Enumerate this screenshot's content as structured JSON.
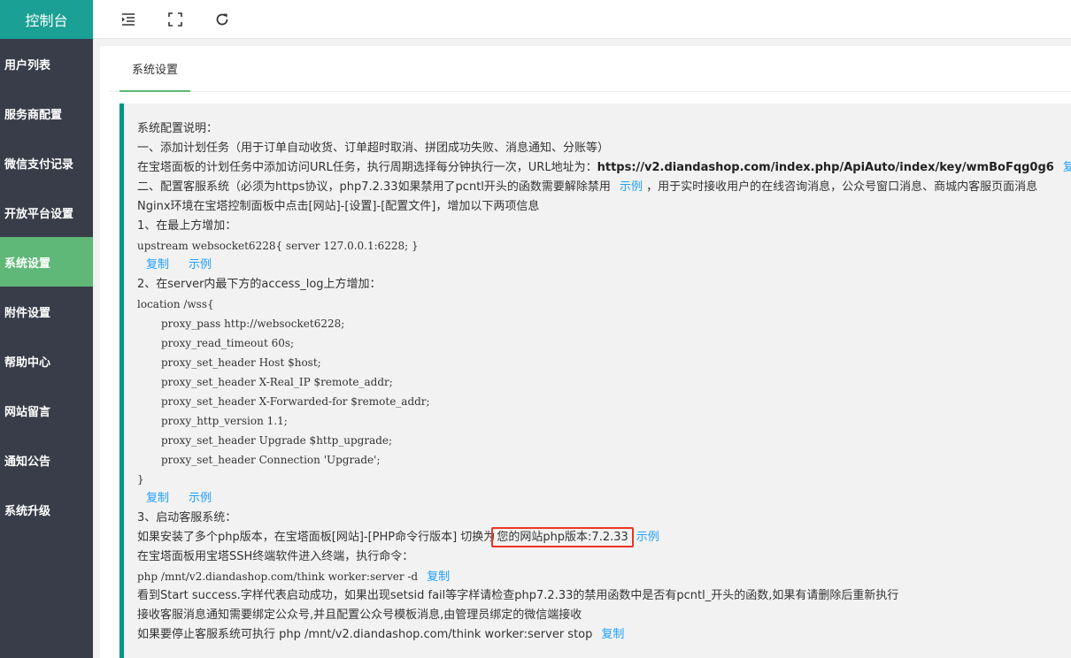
{
  "sidebar": {
    "logo": "控制台",
    "items": [
      {
        "label": "用户列表"
      },
      {
        "label": "服务商配置"
      },
      {
        "label": "微信支付记录"
      },
      {
        "label": "开放平台设置"
      },
      {
        "label": "系统设置",
        "active": true
      },
      {
        "label": "附件设置"
      },
      {
        "label": "帮助中心"
      },
      {
        "label": "网站留言"
      },
      {
        "label": "通知公告"
      },
      {
        "label": "系统升级"
      }
    ]
  },
  "topbar": {
    "icons": [
      "menu-fold-icon",
      "fullscreen-icon",
      "refresh-icon"
    ]
  },
  "tab": {
    "label": "系统设置"
  },
  "colors": {
    "sidebar": "#393d49",
    "logo": "#1aa094",
    "active": "#5fb878",
    "link": "#1e9fff",
    "highlight": "#e32222"
  },
  "doc": {
    "l1": "系统配置说明：",
    "l2": "一、添加计划任务（用于订单自动收货、订单超时取消、拼团成功失败、消息通知、分账等）",
    "l3a": "在宝塔面板的计划任务中添加访问URL任务，执行周期选择每分钟执行一次，URL地址为：",
    "l3url": "https://v2.diandashop.com/index.php/ApiAuto/index/key/wmBoFqg0g6",
    "l3copy": "复制",
    "l4a": "二、配置客服系统（必须为https协议，php7.2.33如果禁用了pcntl开头的函数需要解除禁用",
    "l4ex": "示例",
    "l4b": "，用于实时接收用户的在线咨询消息，公众号窗口消息、商城内客服页面消息",
    "l5": "Nginx环境在宝塔控制面板中点击[网站]-[设置]-[配置文件]，增加以下两项信息",
    "l6": "1、在最上方增加：",
    "l7": "upstream websocket6228{ server 127.0.0.1:6228; }",
    "copy": "复制",
    "example": "示例",
    "l9": "2、在server内最下方的access_log上方增加：",
    "l10": "location /wss{",
    "code": [
      "proxy_pass http://websocket6228;",
      "proxy_read_timeout 60s;",
      "proxy_set_header Host $host;",
      "proxy_set_header X-Real_IP $remote_addr;",
      "proxy_set_header X-Forwarded-for $remote_addr;",
      "proxy_http_version 1.1;",
      "proxy_set_header Upgrade $http_upgrade;",
      "proxy_set_header Connection 'Upgrade';"
    ],
    "l19": "}",
    "l21": "3、启动客服系统：",
    "l22a": "如果安装了多个php版本，在宝塔面板[网站]-[PHP命令行版本] 切换为",
    "l22hl": "您的网站php版本:7.2.33",
    "l22ex": "示例",
    "l23": "在宝塔面板用宝塔SSH终端软件进入终端，执行命令：",
    "l24": "php /mnt/v2.diandashop.com/think worker:server -d",
    "l24copy": "复制",
    "l25": "看到Start success.字样代表启动成功，如果出现setsid fail等字样请检查php7.2.33的禁用函数中是否有pcntl_开头的函数,如果有请删除后重新执行",
    "l26": "接收客服消息通知需要绑定公众号,并且配置公众号模板消息,由管理员绑定的微信端接收",
    "l27a": "如果要停止客服系统可执行",
    "l27cmd": "php /mnt/v2.diandashop.com/think worker:server stop",
    "l27copy": "复制"
  }
}
